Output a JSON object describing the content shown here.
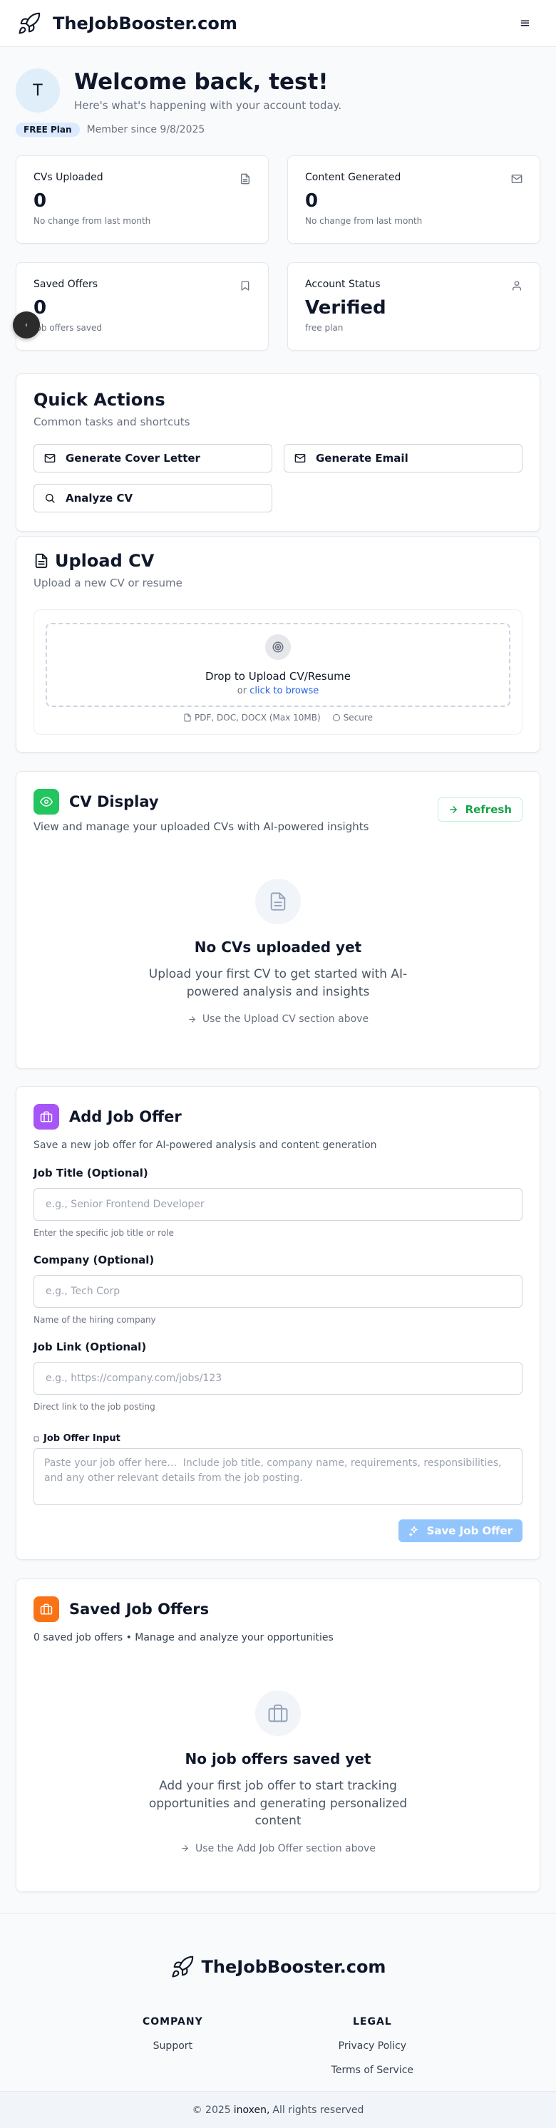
{
  "header": {
    "brand": "TheJobBooster.com",
    "menu_icon": "≡"
  },
  "welcome": {
    "avatar_initial": "T",
    "title": "Welcome back, test!",
    "subtitle": "Here's what's happening with your account today.",
    "plan_badge": "FREE Plan",
    "member_since": "Member since 9/8/2025"
  },
  "stats": [
    {
      "label": "CVs Uploaded",
      "value": "0",
      "note": "No change from last month",
      "icon": "document-icon"
    },
    {
      "label": "Content Generated",
      "value": "0",
      "note": "No change from last month",
      "icon": "mail-icon"
    },
    {
      "label": "Saved Offers",
      "value": "0",
      "note": "Job offers saved",
      "icon": "bookmark-icon"
    },
    {
      "label": "Account Status",
      "value": "Verified",
      "note": "free plan",
      "icon": "user-icon"
    }
  ],
  "quick_actions": {
    "title": "Quick Actions",
    "subtitle": "Common tasks and shortcuts",
    "buttons": [
      "Generate Cover Letter",
      "Generate Email",
      "Analyze CV"
    ]
  },
  "upload_cv": {
    "title": "Upload CV",
    "subtitle": "Upload a new CV or resume",
    "drop_text": "Drop to Upload CV/Resume",
    "or_text": "or",
    "browse_link": "click to browse",
    "formats": "PDF, DOC, DOCX (Max 10MB)",
    "secure": "Secure"
  },
  "cv_display": {
    "title": "CV Display",
    "subtitle": "View and manage your uploaded CVs with AI-powered insights",
    "refresh": "Refresh",
    "empty_title": "No CVs uploaded yet",
    "empty_desc": "Upload your first CV to get started with AI-powered analysis and insights",
    "empty_hint": "Use the Upload CV section above",
    "accent": "#22c55e"
  },
  "add_job": {
    "title": "Add Job Offer",
    "subtitle": "Save a new job offer for AI-powered analysis and content generation",
    "job_title_label": "Job Title (Optional)",
    "job_title_placeholder": "e.g., Senior Frontend Developer",
    "job_title_hint": "Enter the specific job title or role",
    "company_label": "Company (Optional)",
    "company_placeholder": "e.g., Tech Corp",
    "company_hint": "Name of the hiring company",
    "link_label": "Job Link (Optional)",
    "link_placeholder": "e.g., https://company.com/jobs/123",
    "link_hint": "Direct link to the job posting",
    "input_label": "Job Offer Input",
    "input_placeholder": "Paste your job offer here...  Include job title, company name, requirements, responsibilities, and any other relevant details from the job posting.",
    "save_button": "Save Job Offer",
    "accent": "#a855f7"
  },
  "saved_offers": {
    "title": "Saved Job Offers",
    "subtitle": "0 saved job offers • Manage and analyze your opportunities",
    "empty_title": "No job offers saved yet",
    "empty_desc": "Add your first job offer to start tracking opportunities and generating personalized content",
    "empty_hint": "Use the Add Job Offer section above",
    "accent": "#f97316"
  },
  "footer": {
    "brand": "TheJobBooster.com",
    "company_heading": "COMPANY",
    "company_links": [
      "Support"
    ],
    "legal_heading": "LEGAL",
    "legal_links": [
      "Privacy Policy",
      "Terms of Service"
    ],
    "copyright_prefix": "© 2025",
    "copyright_company": "inoxen,",
    "copyright_suffix": "All rights reserved"
  }
}
